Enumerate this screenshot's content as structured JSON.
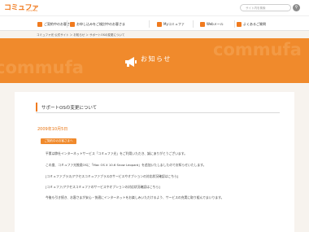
{
  "header": {
    "logo": "コミュファ",
    "logo_sub": "commufa",
    "search_placeholder": "サイト内を検索",
    "search_icon": "search-icon"
  },
  "nav": {
    "items": [
      {
        "label": "ご契約中のお客さま",
        "icon": "user-icon"
      },
      {
        "label": "お申し込みをご検討中のお客さま",
        "icon": "form-icon"
      },
      {
        "label": "Myコミュファ",
        "icon": "heart-icon"
      },
      {
        "label": "Webメール",
        "icon": "mail-icon"
      },
      {
        "label": "よくあるご質問",
        "icon": "question-icon"
      }
    ]
  },
  "breadcrumb": "コミュファ光 公式サイト ＞ お知らせ ＞ サポートOSの変更について",
  "banner": {
    "title": "お知らせ",
    "watermark": "commufa",
    "icon": "megaphone-icon"
  },
  "article": {
    "heading": "サポートOSの変更について",
    "date": "2009年10月5日",
    "badge": "ご契約中のお客さまへ",
    "paragraphs": [
      "平素は弊社インターネットサービス「コミュファ光」をご利用いただき、誠にありがとうございます。",
      "この度、コミュファ光推奨OSに「Mac OS X 10.6 Snow Leopard」を追加いたしましたのでお知らせいたします。",
      "[コミュファプラス/アクセスコミュファプラスのサービスやオプションの対応状況確認はこちら]",
      "[コミュファ/アクセスコミュファのサービスやオプションの対応状況確認はこちら]",
      "今後も引き続き、お客さまが安心・快適にインターネットをお楽しみいただけるよう、サービスの充実に取り組んでまいります。"
    ]
  },
  "colors": {
    "accent": "#f07a1e",
    "banner": "#f08a2c",
    "background": "#f7f3ee"
  }
}
